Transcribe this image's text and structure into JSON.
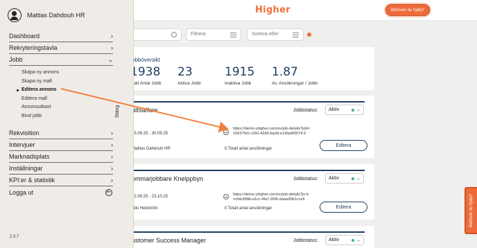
{
  "header": {
    "brand": "Higher",
    "help_button": "Behöver du hjälp?"
  },
  "filters": {
    "search_placeholder": "k",
    "filter_label": "Filtrera",
    "sort_label": "Sortera efter"
  },
  "overview": {
    "title": "obböversikt",
    "stats": [
      {
        "value": "1938",
        "label": "otalt Antal Jobb"
      },
      {
        "value": "23",
        "label": "Aktiva Jobb"
      },
      {
        "value": "1915",
        "label": "Inaktiva Jobb"
      },
      {
        "value": "1.87",
        "label": "Av. Ansökningar / Jobb"
      }
    ]
  },
  "jobs": [
    {
      "title": "ättsäffare",
      "status_label": "Jobbstatus:",
      "status": "Aktiv",
      "dates": "15.09.25 - 30.09.25",
      "owner": "Mattias Dahdouh HR",
      "url": "https://demo.uhigher.com/sv/job-details?job=15637fe5-c260-42d6-ba3d-e13fad43074 6",
      "applicants": "0 Totalt antal ansökningar",
      "edit_label": "Editera"
    },
    {
      "title": "ommarjobbare Kneippbyn",
      "status_label": "Jobbstatus:",
      "status": "Aktiv",
      "dates": "12.09.25 - 23.10.25",
      "owner": "Nils Hedström",
      "url": "https://demo.uhigher.com/sv/job-details?jo b=cfdcd58b-a1cc-4fa7-9f36-daaa90b1cce6",
      "applicants": "0 Totalt antal ansökningar",
      "edit_label": "Editera"
    },
    {
      "title": "ustomer Success Manager",
      "status_label": "Jobbstatus:",
      "status": "Aktiv"
    }
  ],
  "feedback_tab": "Behöver du hjälp?",
  "drawer": {
    "user_name": "Mattias Dahdouh HR",
    "close_label": "Stäng",
    "menu_top": [
      {
        "label": "Dashboard"
      },
      {
        "label": "Rekryteringstavla"
      },
      {
        "label": "Jobb"
      }
    ],
    "job_submenu": [
      {
        "label": "Skapa ny annons"
      },
      {
        "label": "Skapa ny mall"
      },
      {
        "label": "Editera annons"
      },
      {
        "label": "Editera mall"
      },
      {
        "label": "Annonsutkast"
      },
      {
        "label": "Bind jobb"
      }
    ],
    "menu_bottom": [
      {
        "label": "Rekvisition"
      },
      {
        "label": "Intervjuer"
      },
      {
        "label": "Marknadsplats"
      },
      {
        "label": "Inställningar"
      },
      {
        "label": "KPI:er & statistik"
      },
      {
        "label": "Logga ut"
      }
    ],
    "version": "2.3.7"
  },
  "colors": {
    "brand": "#f0703a",
    "accent_navy": "#1d3b5f",
    "status_green": "#39b37a",
    "annotation_arrow": "#f0823e"
  }
}
